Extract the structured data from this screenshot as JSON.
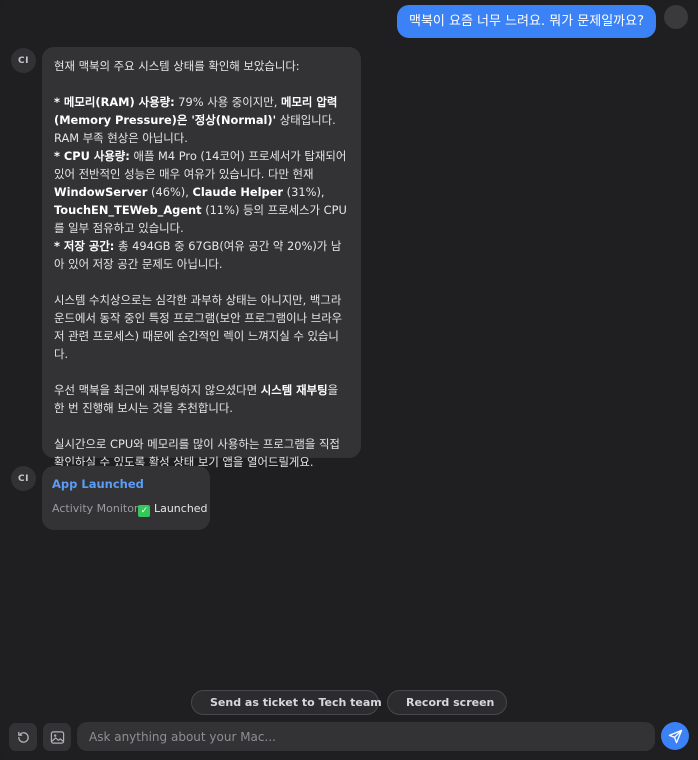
{
  "user_message": "맥북이 요즘 너무 느려요. 뭐가 문제일까요?",
  "assistant": {
    "avatar_initials": "CI",
    "intro": "현재 맥북의 주요 시스템 상태를 확인해 보았습니다:",
    "memory": {
      "label": "* 메모리(RAM) 사용량:",
      "text1": " 79% 사용 중이지만, ",
      "bold2": "메모리 압력 (Memory Pressure)은 '정상(Normal)'",
      "text2": " 상태입니다. RAM 부족 현상은 아닙니다."
    },
    "cpu": {
      "label": "* CPU 사용량:",
      "text1": " 애플 M4 Pro (14코어) 프로세서가 탑재되어 있어 전반적인 성능은 매우 여유가 있습니다. 다만 현재 ",
      "proc1": "WindowServer",
      "pct1": " (46%), ",
      "proc2": "Claude Helper",
      "pct2": " (31%), ",
      "proc3": "TouchEN_TEWeb_Agent",
      "text2": " (11%) 등의 프로세스가 CPU를 일부 점유하고 있습니다."
    },
    "storage": {
      "label": "* 저장 공간:",
      "text": " 총 494GB 중 67GB(여유 공간 약 20%)가 남아 있어 저장 공간 문제도 아닙니다."
    },
    "para2": "시스템 수치상으로는 심각한 과부하 상태는 아니지만, 백그라운드에서 동작 중인 특정 프로그램(보안 프로그램이나 브라우저 관련 프로세스) 때문에 순간적인 렉이 느껴지실 수 있습니다.",
    "para3": {
      "text1": "우선 맥북을 최근에 재부팅하지 않으셨다면 ",
      "bold": "시스템 재부팅",
      "text2": "을 한 번 진행해 보시는 것을 추천합니다."
    },
    "para4": "실시간으로 CPU와 메모리를 많이 사용하는 프로그램을 직접 확인하실 수 있도록 활성 상태 보기 앱을 열어드릴게요."
  },
  "launch": {
    "avatar_initials": "CI",
    "title": "App Launched",
    "app_name": "Activity Monitor",
    "check_icon": "check-box-icon",
    "status": "Launched"
  },
  "actions": {
    "ticket_label": "Send as ticket to Tech team",
    "ticket_icon": "envelope-icon",
    "record_label": "Record screen",
    "record_icon": "record-dot-icon"
  },
  "composer": {
    "placeholder": "Ask anything about your Mac...",
    "history_icon": "history-icon",
    "image_icon": "image-icon",
    "send_icon": "send-icon"
  },
  "colors": {
    "accent": "#3b82f6",
    "link": "#5b9cf6",
    "record": "#ff453a",
    "check": "#34c759",
    "bubble": "#333336",
    "background": "#1f1f21"
  }
}
